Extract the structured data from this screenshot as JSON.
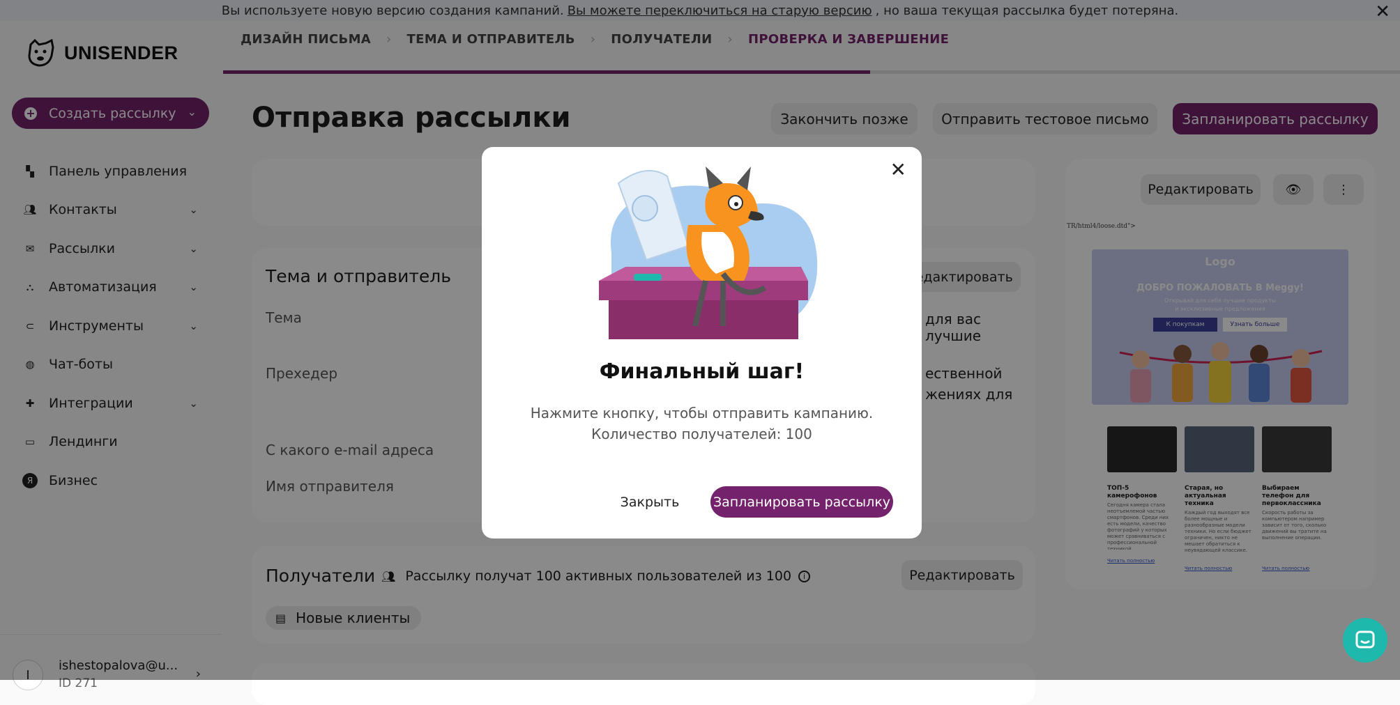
{
  "notice": {
    "text_before": "Вы используете новую версию создания кампаний.",
    "link": "Вы можете переключиться на старую версию",
    "text_after": ", но ваша текущая рассылка будет потеряна.",
    "close": "✕"
  },
  "brand": {
    "name": "UNISENDER"
  },
  "sidebar": {
    "create_label": "Создать рассылку",
    "items": [
      {
        "label": "Панель управления",
        "icon": "dashboard-icon",
        "expandable": false
      },
      {
        "label": "Контакты",
        "icon": "contacts-icon",
        "expandable": true
      },
      {
        "label": "Рассылки",
        "icon": "mail-icon",
        "expandable": true
      },
      {
        "label": "Автоматизация",
        "icon": "automation-icon",
        "expandable": true
      },
      {
        "label": "Инструменты",
        "icon": "tools-icon",
        "expandable": true
      },
      {
        "label": "Чат-боты",
        "icon": "bot-icon",
        "expandable": false
      },
      {
        "label": "Интеграции",
        "icon": "puzzle-icon",
        "expandable": true
      },
      {
        "label": "Лендинги",
        "icon": "landing-icon",
        "expandable": false
      },
      {
        "label": "Бизнес",
        "icon": "business-icon",
        "expandable": false
      }
    ],
    "user": {
      "initial": "I",
      "email": "ishestopalova@u...",
      "id": "ID 271"
    }
  },
  "steps": [
    {
      "label": "ДИЗАЙН ПИСЬМА",
      "active": false
    },
    {
      "label": "ТЕМА И ОТПРАВИТЕЛЬ",
      "active": false
    },
    {
      "label": "ПОЛУЧАТЕЛИ",
      "active": false
    },
    {
      "label": "ПРОВЕРКА И ЗАВЕРШЕНИЕ",
      "active": true
    }
  ],
  "progress": 0.55,
  "header": {
    "title": "Отправка рассылки",
    "finish_later": "Закончить позже",
    "send_test": "Отправить тестовое письмо",
    "schedule": "Запланировать рассылку"
  },
  "subject_card": {
    "title": "Тема и отправитель",
    "edit": "Редактировать",
    "subject_label": "Тема",
    "subject_value_partial": "для вас лучшие",
    "preheader_label": "Прехедер",
    "preheader_value_partial_1": "ественной",
    "preheader_value_partial_2": "жениях для",
    "from_email_label": "С какого e-mail адреса",
    "sender_name_label": "Имя отправителя"
  },
  "recipients_card": {
    "title": "Получатели",
    "summary": "Рассылку получат 100 активных пользователей из 100",
    "edit": "Редактировать",
    "segment": "Новые клиенты"
  },
  "preview": {
    "edit": "Редактировать",
    "raw_text": "TR/html4/loose.dtd\">",
    "logo": "Logo",
    "welcome": "ДОБРО ПОЖАЛОВАТЬ В Meggy!",
    "sub1": "Открывай для себя лучшие продукты",
    "sub2": "и эксклюзивные предложения",
    "btn_shop": "К покупкам",
    "btn_more": "Узнать больше",
    "products": [
      {
        "title": "ТОП-5 камерофонов",
        "text": "Сегодня камера стала неотъемлемой частью смартфонов. Среди них есть модели, качество фотографий у которых может сравниваться с профессиональной техникой.",
        "link": "Читать полностью",
        "color": "#2a2a2a"
      },
      {
        "title": "Старая, но актуальная техника",
        "text": "Каждый год выходят все более мощные и разнообразные модели техники. Но если бюджет ограничен, никто не мешает обратиться к неувядающей классике.",
        "link": "Читать полностью",
        "color": "#55677a"
      },
      {
        "title": "Выбираем телефон для первоклассника",
        "text": "Скорость работы за компьютером например зависит от того, сколько движений вы тратите на выполнение операции.",
        "link": "Читать полностью",
        "color": "#3a3a3a"
      }
    ]
  },
  "modal": {
    "title": "Финальный шаг!",
    "line1": "Нажмите кнопку, чтобы отправить кампанию.",
    "line2": "Количество получателей: 100",
    "cancel": "Закрыть",
    "confirm": "Запланировать рассылку",
    "close": "✕"
  },
  "colors": {
    "brand": "#75226c",
    "chat": "#1fb8ad",
    "preview_banner": "#c7cbf1"
  }
}
